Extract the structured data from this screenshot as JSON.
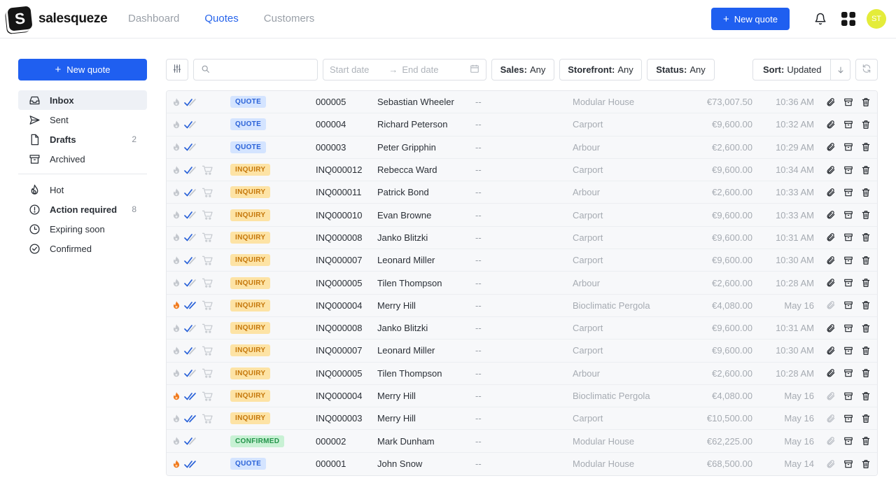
{
  "brand": {
    "name": "salesqueze",
    "mark": "S"
  },
  "nav": [
    {
      "label": "Dashboard",
      "active": false
    },
    {
      "label": "Quotes",
      "active": true
    },
    {
      "label": "Customers",
      "active": false
    }
  ],
  "header": {
    "new_quote_label": "New quote",
    "avatar_initials": "ST"
  },
  "sidebar": {
    "new_quote_label": "New quote",
    "items": [
      {
        "label": "Inbox",
        "icon": "inbox-icon",
        "count": "",
        "bold": true,
        "active": true
      },
      {
        "label": "Sent",
        "icon": "send-icon",
        "count": "",
        "bold": false,
        "active": false
      },
      {
        "label": "Drafts",
        "icon": "document-icon",
        "count": "2",
        "bold": true,
        "active": false
      },
      {
        "label": "Archived",
        "icon": "archive-icon",
        "count": "",
        "bold": false,
        "active": false
      }
    ],
    "filters": [
      {
        "label": "Hot",
        "icon": "flame-icon",
        "count": "",
        "bold": false
      },
      {
        "label": "Action required",
        "icon": "alert-circle-icon",
        "count": "8",
        "bold": true
      },
      {
        "label": "Expiring soon",
        "icon": "clock-icon",
        "count": "",
        "bold": false
      },
      {
        "label": "Confirmed",
        "icon": "check-circle-icon",
        "count": "",
        "bold": false
      }
    ]
  },
  "toolbar": {
    "search_placeholder": "",
    "start_date_placeholder": "Start date",
    "end_date_placeholder": "End date",
    "sales_key": "Sales:",
    "sales_value": "Any",
    "storefront_key": "Storefront:",
    "storefront_value": "Any",
    "status_key": "Status:",
    "status_value": "Any",
    "sort_key": "Sort:",
    "sort_value": "Updated"
  },
  "rows": [
    {
      "hot": false,
      "read": "single",
      "cart": false,
      "badge": "QUOTE",
      "id": "000005",
      "name": "Sebastian Wheeler",
      "note": "--",
      "product": "Modular House",
      "amount": "€73,007.50",
      "time": "10:36 AM",
      "clip": true
    },
    {
      "hot": false,
      "read": "single",
      "cart": false,
      "badge": "QUOTE",
      "id": "000004",
      "name": "Richard Peterson",
      "note": "--",
      "product": "Carport",
      "amount": "€9,600.00",
      "time": "10:32 AM",
      "clip": true
    },
    {
      "hot": false,
      "read": "single",
      "cart": false,
      "badge": "QUOTE",
      "id": "000003",
      "name": "Peter Gripphin",
      "note": "--",
      "product": "Arbour",
      "amount": "€2,600.00",
      "time": "10:29 AM",
      "clip": true
    },
    {
      "hot": false,
      "read": "single",
      "cart": true,
      "badge": "INQUIRY",
      "id": "INQ000012",
      "name": "Rebecca Ward",
      "note": "--",
      "product": "Carport",
      "amount": "€9,600.00",
      "time": "10:34 AM",
      "clip": true
    },
    {
      "hot": false,
      "read": "single",
      "cart": true,
      "badge": "INQUIRY",
      "id": "INQ000011",
      "name": "Patrick Bond",
      "note": "--",
      "product": "Arbour",
      "amount": "€2,600.00",
      "time": "10:33 AM",
      "clip": true
    },
    {
      "hot": false,
      "read": "single",
      "cart": true,
      "badge": "INQUIRY",
      "id": "INQ000010",
      "name": "Evan Browne",
      "note": "--",
      "product": "Carport",
      "amount": "€9,600.00",
      "time": "10:33 AM",
      "clip": true
    },
    {
      "hot": false,
      "read": "single",
      "cart": true,
      "badge": "INQUIRY",
      "id": "INQ000008",
      "name": "Janko Blitzki",
      "note": "--",
      "product": "Carport",
      "amount": "€9,600.00",
      "time": "10:31 AM",
      "clip": true
    },
    {
      "hot": false,
      "read": "single",
      "cart": true,
      "badge": "INQUIRY",
      "id": "INQ000007",
      "name": "Leonard Miller",
      "note": "--",
      "product": "Carport",
      "amount": "€9,600.00",
      "time": "10:30 AM",
      "clip": true
    },
    {
      "hot": false,
      "read": "single",
      "cart": true,
      "badge": "INQUIRY",
      "id": "INQ000005",
      "name": "Tilen Thompson",
      "note": "--",
      "product": "Arbour",
      "amount": "€2,600.00",
      "time": "10:28 AM",
      "clip": true
    },
    {
      "hot": true,
      "read": "double",
      "cart": true,
      "badge": "INQUIRY",
      "id": "INQ000004",
      "name": "Merry Hill",
      "note": "--",
      "product": "Bioclimatic Pergola",
      "amount": "€4,080.00",
      "time": "May 16",
      "clip": false
    },
    {
      "hot": false,
      "read": "single",
      "cart": true,
      "badge": "INQUIRY",
      "id": "INQ000008",
      "name": "Janko Blitzki",
      "note": "--",
      "product": "Carport",
      "amount": "€9,600.00",
      "time": "10:31 AM",
      "clip": true
    },
    {
      "hot": false,
      "read": "single",
      "cart": true,
      "badge": "INQUIRY",
      "id": "INQ000007",
      "name": "Leonard Miller",
      "note": "--",
      "product": "Carport",
      "amount": "€9,600.00",
      "time": "10:30 AM",
      "clip": true
    },
    {
      "hot": false,
      "read": "single",
      "cart": true,
      "badge": "INQUIRY",
      "id": "INQ000005",
      "name": "Tilen Thompson",
      "note": "--",
      "product": "Arbour",
      "amount": "€2,600.00",
      "time": "10:28 AM",
      "clip": true
    },
    {
      "hot": true,
      "read": "double",
      "cart": true,
      "badge": "INQUIRY",
      "id": "INQ000004",
      "name": "Merry Hill",
      "note": "--",
      "product": "Bioclimatic Pergola",
      "amount": "€4,080.00",
      "time": "May 16",
      "clip": false
    },
    {
      "hot": false,
      "read": "double",
      "cart": true,
      "badge": "INQUIRY",
      "id": "INQ000003",
      "name": "Merry Hill",
      "note": "--",
      "product": "Carport",
      "amount": "€10,500.00",
      "time": "May 16",
      "clip": false
    },
    {
      "hot": false,
      "read": "single",
      "cart": false,
      "badge": "CONFIRMED",
      "id": "000002",
      "name": "Mark Dunham",
      "note": "--",
      "product": "Modular House",
      "amount": "€62,225.00",
      "time": "May 16",
      "clip": false
    },
    {
      "hot": true,
      "read": "double",
      "cart": false,
      "badge": "QUOTE",
      "id": "000001",
      "name": "John Snow",
      "note": "--",
      "product": "Modular House",
      "amount": "€68,500.00",
      "time": "May 14",
      "clip": false
    }
  ],
  "colors": {
    "accent": "#1f5ff0",
    "hot": "#f07a1e",
    "check": "#2a62d8",
    "avatar": "#e4ec3a"
  }
}
